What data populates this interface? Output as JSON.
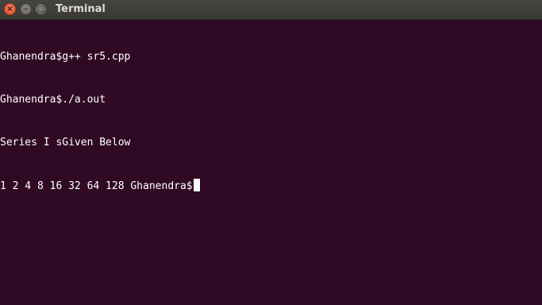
{
  "window": {
    "title": "Terminal",
    "controls": {
      "close": "×",
      "minimize": "–",
      "maximize": "□"
    }
  },
  "terminal": {
    "lines": [
      "Ghanendra$g++ sr5.cpp",
      "Ghanendra$./a.out",
      "Series I sGiven Below",
      "1 2 4 8 16 32 64 128 Ghanendra$"
    ]
  },
  "colors": {
    "background": "#300a24",
    "titlebar": "#3c3b37",
    "close_button": "#e95420",
    "text": "#ffffff"
  }
}
